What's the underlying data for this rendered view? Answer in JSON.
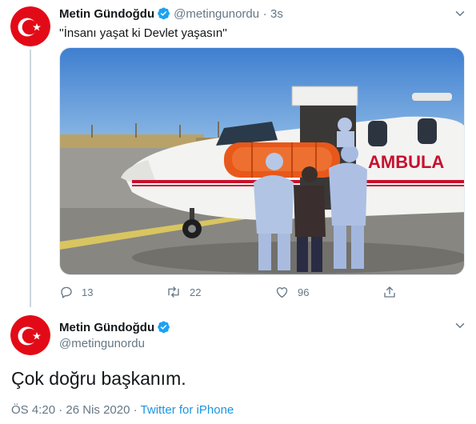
{
  "tweet1": {
    "author": "Metin Gündoğdu",
    "handle": "@metingunordu",
    "separator": "·",
    "time": "3s",
    "text": "''İnsanı yaşat ki Devlet yaşasın''",
    "photo_text": "AMBULA",
    "actions": {
      "replies": "13",
      "retweets": "22",
      "likes": "96"
    }
  },
  "tweet2": {
    "author": "Metin Gündoğdu",
    "handle": "@metingunordu",
    "text": "Çok doğru başkanım.",
    "time": "ÖS 4:20",
    "separator": "·",
    "date": "26 Nis 2020",
    "separator2": "·",
    "source": "Twitter for iPhone"
  },
  "colors": {
    "accent": "#1da1f2",
    "link": "#1b95e0",
    "muted": "#657786",
    "avatar_red": "#e30a17"
  },
  "icons": [
    "turkish-flag-avatar",
    "verified-badge-icon",
    "chevron-down-icon",
    "reply-icon",
    "retweet-icon",
    "like-icon",
    "share-icon"
  ]
}
